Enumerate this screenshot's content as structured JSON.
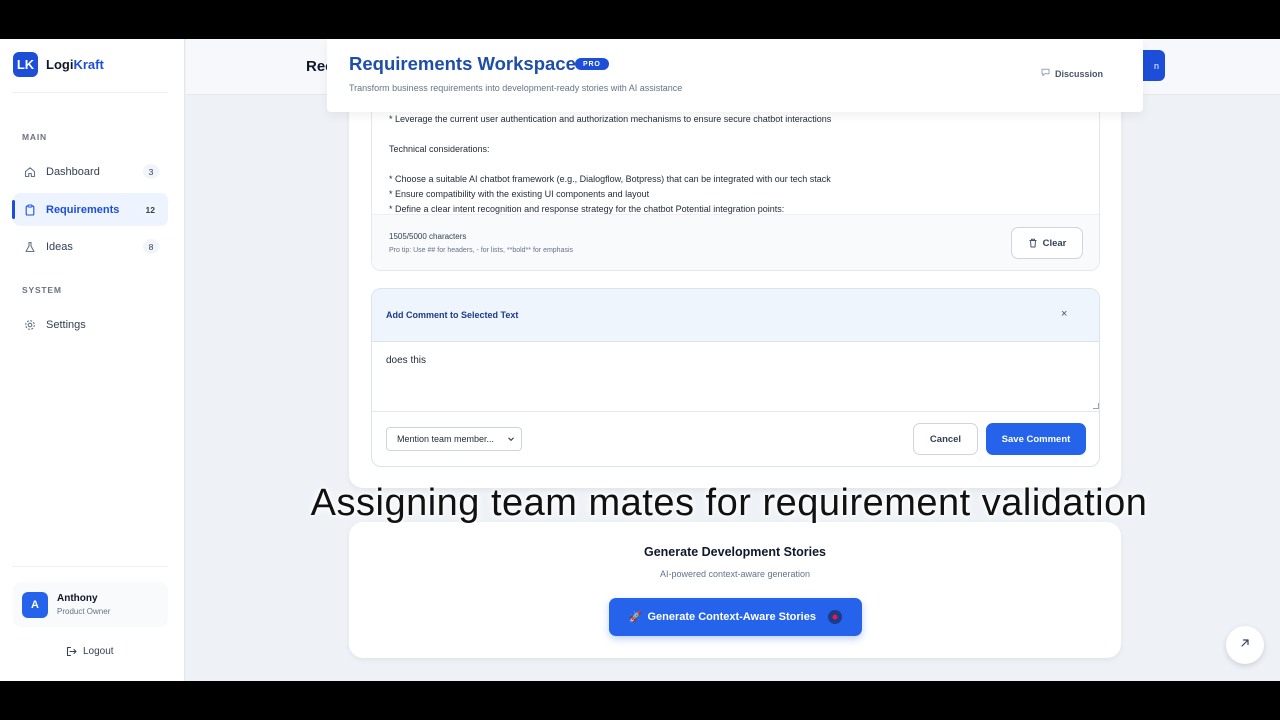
{
  "brand": {
    "logo": "LK",
    "name_prefix": "Logi",
    "name_suffix": "Kraft"
  },
  "sidebar": {
    "main_label": "MAIN",
    "system_label": "SYSTEM",
    "items": [
      {
        "label": "Dashboard",
        "count": "3",
        "icon": "home-icon"
      },
      {
        "label": "Requirements",
        "count": "12",
        "icon": "clipboard-icon"
      },
      {
        "label": "Ideas",
        "count": "8",
        "icon": "flask-icon"
      }
    ],
    "system_items": [
      {
        "label": "Settings",
        "icon": "gear-icon"
      }
    ],
    "user": {
      "initial": "A",
      "name": "Anthony",
      "role": "Product Owner"
    },
    "logout_label": "Logout"
  },
  "background": {
    "title_fragment": "Rec",
    "button_fragment": "n"
  },
  "workspace": {
    "title": "Requirements Workspace",
    "badge": "PRO",
    "subtitle": "Transform business requirements into development-ready stories with AI assistance",
    "discussion_label": "Discussion"
  },
  "editor": {
    "text": "* Leverage the current user authentication and authorization mechanisms to ensure secure chatbot interactions\n\nTechnical considerations:\n\n* Choose a suitable AI chatbot framework (e.g., Dialogflow, Botpress) that can be integrated with our tech stack\n* Ensure compatibility with the existing UI components and layout\n* Define a clear intent recognition and response strategy for the chatbot Potential integration points:",
    "char_count": "1505/5000 characters",
    "pro_tip": "Pro tip: Use ## for headers, - for lists, **bold** for emphasis",
    "clear_label": "Clear"
  },
  "comment": {
    "title": "Add Comment to Selected Text",
    "close": "×",
    "text": "does this",
    "mention_selected": "Mention team member...",
    "cancel_label": "Cancel",
    "save_label": "Save Comment"
  },
  "caption": "Assigning team mates for requirement validation",
  "generate": {
    "title": "Generate Development Stories",
    "subtitle": "AI-powered context-aware generation",
    "button_label": "Generate Context-Aware Stories",
    "button_icon": "🚀"
  },
  "colors": {
    "accent": "#2563eb",
    "brand": "#1d4ed8",
    "heading": "#1e4ea8"
  }
}
